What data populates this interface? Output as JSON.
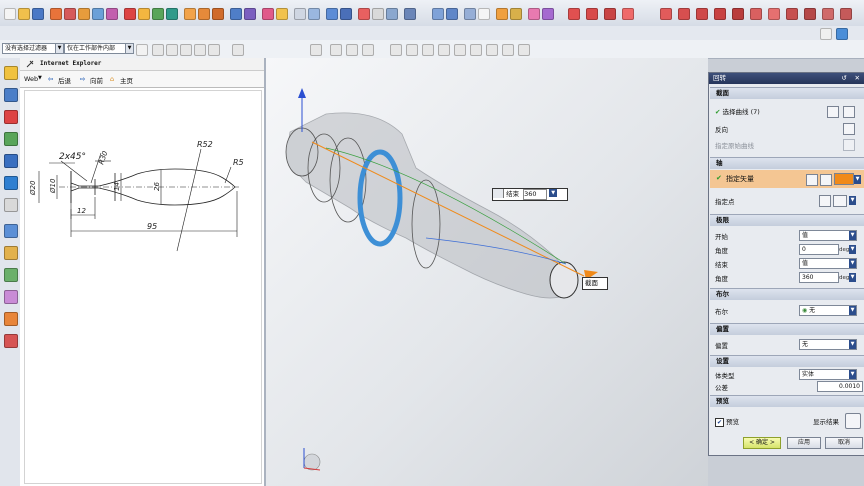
{
  "filter_bar": {
    "type_filter": "没有选择过滤器",
    "scope_filter": "仅在工作部件内部"
  },
  "ie_panel": {
    "title": "Internet Explorer",
    "web_label": "Web",
    "back_label": "后退",
    "forward_label": "向前",
    "home_label": "主页",
    "drawing": {
      "dims": [
        "2x45°",
        "R30",
        "R52",
        "R5",
        "Ø20",
        "Ø10",
        "14",
        "26",
        "12",
        "95"
      ]
    }
  },
  "viewport": {
    "end_tooltip": {
      "label": "结束",
      "value": "360"
    },
    "section_label": "截面"
  },
  "dialog": {
    "title": "回转",
    "section": {
      "header": "截面",
      "select_curve": "选择曲线 (7)",
      "reverse": "反向",
      "sketch_hint": "指定原始曲线"
    },
    "axis": {
      "header": "轴",
      "vector_label": "指定矢量",
      "point_label": "指定点"
    },
    "limits": {
      "header": "极限",
      "start_label": "开始",
      "start_type": "值",
      "start_angle_label": "角度",
      "start_angle_value": "0",
      "end_label": "结束",
      "end_type": "值",
      "end_angle_label": "角度",
      "end_angle_value": "360",
      "unit": "deg"
    },
    "boolean": {
      "header": "布尔",
      "label": "布尔",
      "value": "无"
    },
    "offset": {
      "header": "偏置",
      "label": "偏置",
      "value": "无"
    },
    "settings": {
      "header": "设置",
      "body_type_label": "体类型",
      "body_type_value": "实体",
      "tolerance_label": "公差",
      "tolerance_value": "0.0010"
    },
    "preview": {
      "header": "预览",
      "preview_label": "预览",
      "show_result_label": "显示结果"
    },
    "ok_label": "< 确定 >",
    "apply_label": "应用",
    "cancel_label": "取消"
  },
  "colors": {
    "dialog_header": "#2b3a5f",
    "selection_blue": "#3d8fd6",
    "axis_orange": "#f08a1a"
  }
}
